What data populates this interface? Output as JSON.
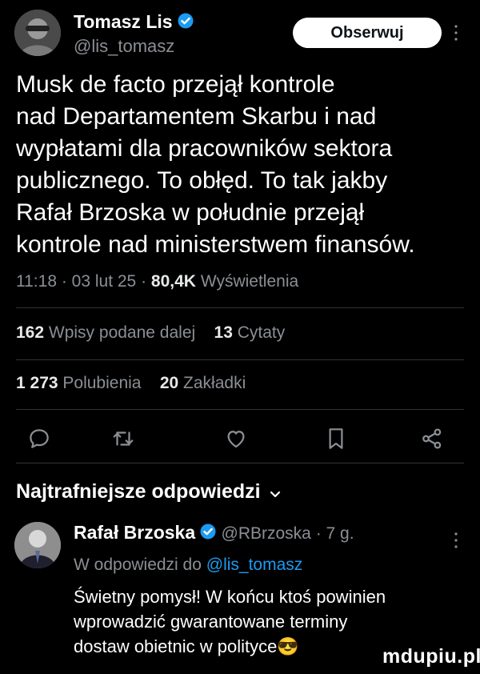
{
  "author": {
    "name": "Tomasz Lis",
    "handle": "@lis_tomasz",
    "follow_label": "Obserwuj"
  },
  "tweet": {
    "text_lines": [
      "Musk de facto przejął kontrole",
      "nad Departamentem Skarbu i nad",
      "wypłatami  dla pracowników sektora",
      "publicznego. To obłęd. To tak jakby",
      "Rafał Brzoska w południe przejął",
      "kontrole nad ministerstwem finansów."
    ],
    "time": "11:18",
    "date": "03 lut 25",
    "views_count": "80,4K",
    "views_label": "Wyświetlenia"
  },
  "stats": {
    "reposts_count": "162",
    "reposts_label": "Wpisy podane dalej",
    "quotes_count": "13",
    "quotes_label": "Cytaty",
    "likes_count": "1 273",
    "likes_label": "Polubienia",
    "bookmarks_count": "20",
    "bookmarks_label": "Zakładki"
  },
  "actions": [
    "reply-icon",
    "repost-icon",
    "like-icon",
    "bookmark-icon",
    "share-icon"
  ],
  "replies_header": "Najtrafniejsze odpowiedzi",
  "reply": {
    "name": "Rafał Brzoska",
    "handle": "@RBrzoska",
    "age": "7 g.",
    "in_reply_prefix": "W odpowiedzi do",
    "in_reply_handle": "@lis_tomasz",
    "text_lines": [
      "Świetny pomysł! W końcu ktoś powinien",
      "wprowadzić gwarantowane terminy",
      "dostaw obietnic w polityce😎"
    ]
  },
  "watermark": "mdupiu.pl",
  "colors": {
    "accent": "#1d9bf0",
    "background": "#000000",
    "text": "#e7e9ea",
    "muted": "#8b8f94"
  }
}
